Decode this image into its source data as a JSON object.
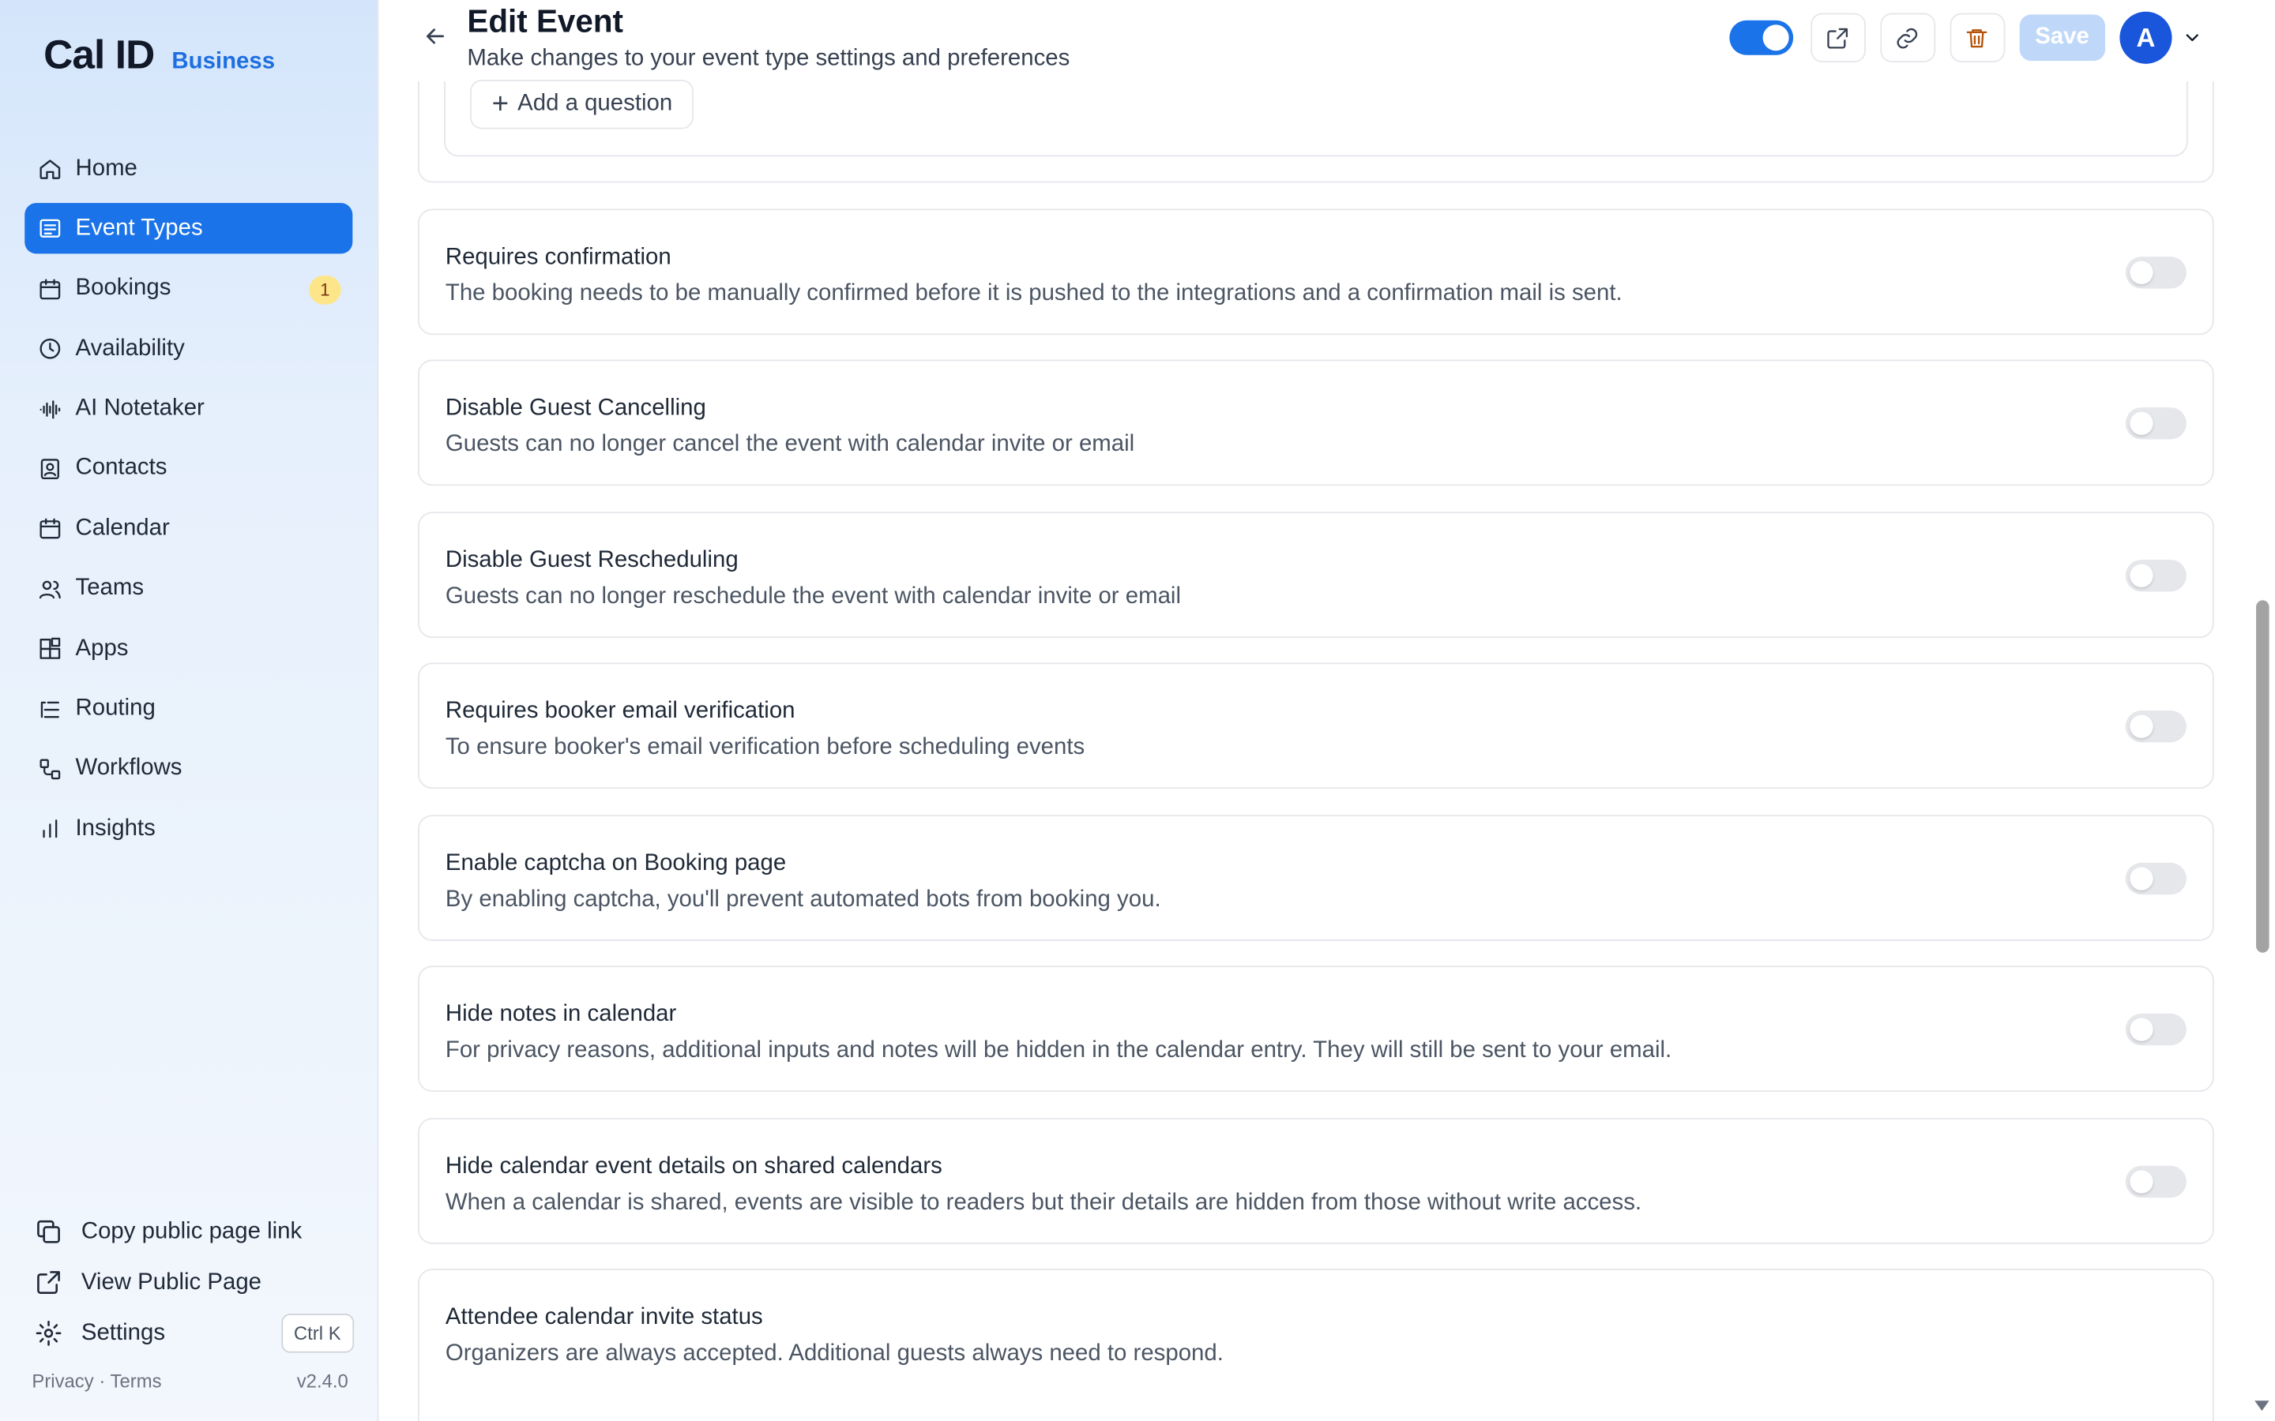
{
  "brand": {
    "logo": "Cal ID",
    "plan": "Business"
  },
  "sidebar": {
    "items": [
      {
        "label": "Home",
        "icon": "home-icon"
      },
      {
        "label": "Event Types",
        "icon": "event-types-icon",
        "active": true
      },
      {
        "label": "Bookings",
        "icon": "calendar-icon",
        "badge": "1"
      },
      {
        "label": "Availability",
        "icon": "clock-icon"
      },
      {
        "label": "AI Notetaker",
        "icon": "waveform-icon"
      },
      {
        "label": "Contacts",
        "icon": "contacts-icon"
      },
      {
        "label": "Calendar",
        "icon": "calendar-icon"
      },
      {
        "label": "Teams",
        "icon": "users-icon"
      },
      {
        "label": "Apps",
        "icon": "apps-icon"
      },
      {
        "label": "Routing",
        "icon": "routing-icon"
      },
      {
        "label": "Workflows",
        "icon": "workflows-icon"
      },
      {
        "label": "Insights",
        "icon": "bar-chart-icon"
      }
    ],
    "bottom": {
      "copy_link": "Copy public page link",
      "view_public": "View Public Page",
      "settings": "Settings",
      "settings_shortcut": "Ctrl K"
    },
    "footer": {
      "privacy": "Privacy",
      "separator": "·",
      "terms": "Terms",
      "version": "v2.4.0"
    }
  },
  "header": {
    "title": "Edit Event",
    "subtitle": "Make changes to your event type settings and preferences",
    "save_label": "Save",
    "avatar_initial": "A",
    "event_enabled": true
  },
  "add_question_label": "Add a question",
  "settings": [
    {
      "title": "Requires confirmation",
      "description": "The booking needs to be manually confirmed before it is pushed to the integrations and a confirmation mail is sent.",
      "enabled": false
    },
    {
      "title": "Disable Guest Cancelling",
      "description": "Guests can no longer cancel the event with calendar invite or email",
      "enabled": false
    },
    {
      "title": "Disable Guest Rescheduling",
      "description": "Guests can no longer reschedule the event with calendar invite or email",
      "enabled": false
    },
    {
      "title": "Requires booker email verification",
      "description": "To ensure booker's email verification before scheduling events",
      "enabled": false
    },
    {
      "title": "Enable captcha on Booking page",
      "description": "By enabling captcha, you'll prevent automated bots from booking you.",
      "enabled": false
    },
    {
      "title": "Hide notes in calendar",
      "description": "For privacy reasons, additional inputs and notes will be hidden in the calendar entry. They will still be sent to your email.",
      "enabled": false
    },
    {
      "title": "Hide calendar event details on shared calendars",
      "description": "When a calendar is shared, events are visible to readers but their details are hidden from those without write access.",
      "enabled": false
    },
    {
      "title": "Attendee calendar invite status",
      "description": "Organizers are always accepted. Additional guests always need to respond."
    }
  ],
  "colors": {
    "accent": "#1a73e8",
    "badge": "#fde68a"
  }
}
